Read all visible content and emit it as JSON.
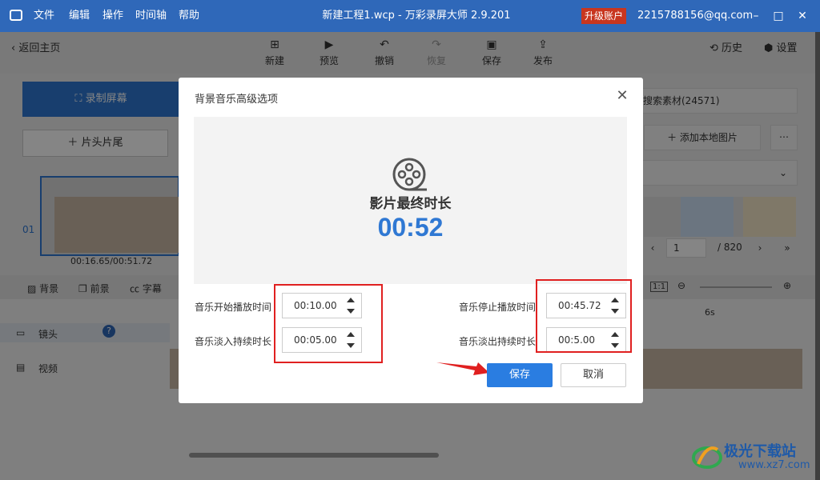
{
  "titlebar": {
    "menu": [
      "文件",
      "编辑",
      "操作",
      "时间轴",
      "帮助"
    ],
    "title": "新建工程1.wcp - 万彩录屏大师 2.9.201",
    "upgrade": "升级账户",
    "email": "2215788156@qq.com"
  },
  "toolbar": {
    "back": "返回主页",
    "new": "新建",
    "preview": "预览",
    "undo": "撤销",
    "redo": "恢复",
    "save": "保存",
    "publish": "发布",
    "history": "历史",
    "settings": "设置"
  },
  "left_panel": {
    "record_screen": "录制屏幕",
    "head_tail": "片头片尾",
    "clip_index": "01",
    "clip_time": "00:16.65/00:51.72"
  },
  "right_panel": {
    "search_material": "搜索素材(24571)",
    "add_local_image": "添加本地图片",
    "page_current": "1",
    "page_total": "/ 820"
  },
  "timeline": {
    "tabs": [
      "背景",
      "前景",
      "字幕"
    ],
    "tracks": [
      "镜头",
      "视频"
    ],
    "ruler_mark": "6s",
    "zoom_label": "1:1"
  },
  "dialog": {
    "title": "背景音乐高级选项",
    "final_label": "影片最终时长",
    "final_time": "00:52",
    "music_start_label": "音乐开始播放时间",
    "music_start_value": "00:10.00",
    "fade_in_label": "音乐淡入持续时长",
    "fade_in_value": "00:05.00",
    "music_stop_label": "音乐停止播放时间",
    "music_stop_value": "00:45.72",
    "fade_out_label": "音乐淡出持续时长",
    "fade_out_value": "00:5.00",
    "save": "保存",
    "cancel": "取消"
  },
  "watermark": {
    "name": "极光下载站",
    "url": "www.xz7.com"
  },
  "colors": {
    "titlebar": "#2f68b9",
    "accent": "#2a7de1",
    "highlight_box": "#e02020",
    "upgrade": "#c8361f"
  }
}
